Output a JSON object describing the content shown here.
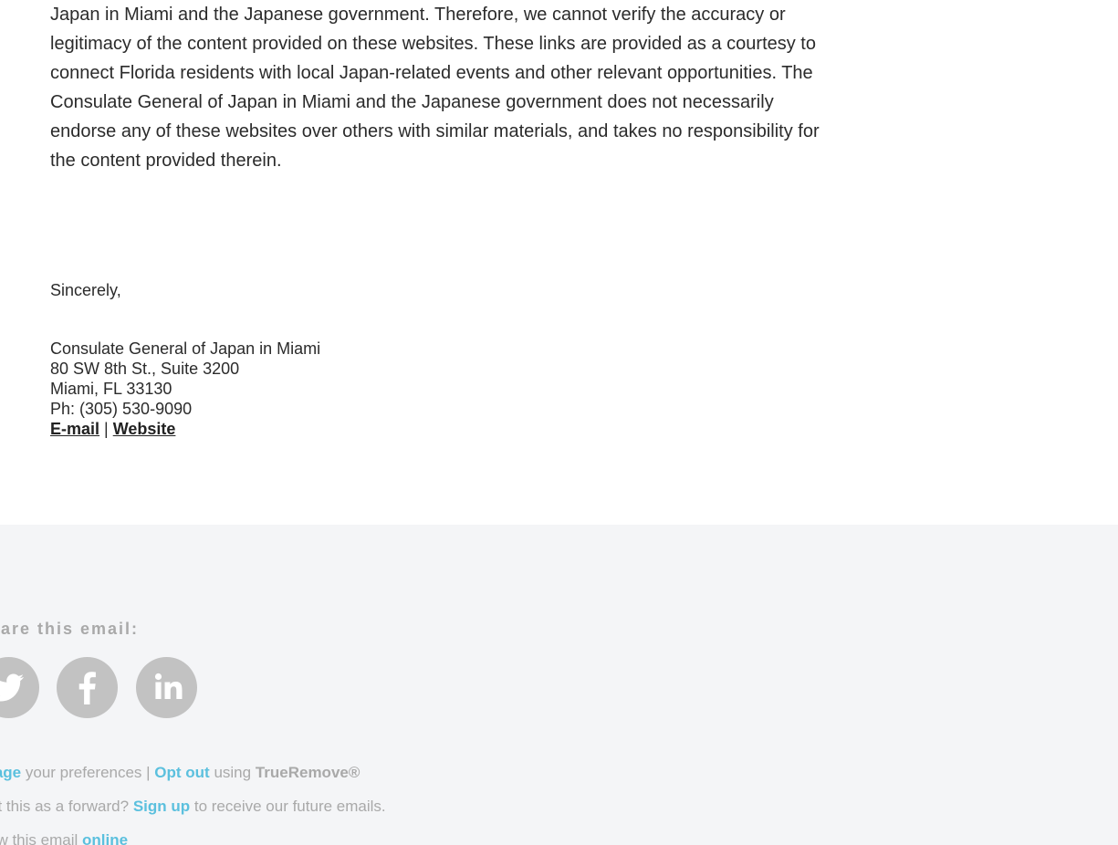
{
  "disclaimer": {
    "line1": "Japan in Miami and the Japanese government. Therefore, we cannot verify the accuracy or",
    "line2": "legitimacy of the content provided on these websites. These links are provided as a courtesy to",
    "line3": "connect Florida residents with local Japan-related events and other relevant opportunities. The",
    "line4": "Consulate General of Japan in Miami and the Japanese government does not necessarily",
    "line5": "endorse any of these websites over others with similar materials, and takes no responsibility for",
    "line6": "the content provided therein."
  },
  "closing": "Sincerely,",
  "signature": {
    "org": "Consulate General of Japan in Miami",
    "address1": "80 SW 8th St., Suite 3200",
    "address2": "Miami, FL 33130",
    "phone": "Ph: (305) 530-9090",
    "email_link": "E-mail",
    "separator": " | ",
    "website_link": "Website"
  },
  "footer": {
    "share_title": "hare this email:",
    "social_icons": [
      "twitter-icon",
      "facebook-icon",
      "linkedin-icon"
    ],
    "manage_link": "anage",
    "manage_rest": " your preferences | ",
    "optout_link": "Opt out",
    "optout_rest": " using ",
    "trueremove": "TrueRemove®",
    "forward_prefix": "ot this as a forward? ",
    "signup_link": "Sign up",
    "forward_suffix": " to receive our future emails.",
    "view_prefix": "ew this email ",
    "online_link": "online"
  },
  "colors": {
    "text": "#2b2b2b",
    "footer_bg": "#f4f5f7",
    "footer_text": "#a9a9a9",
    "link_accent": "#5bc0de",
    "social_bg": "#c2c2c2"
  }
}
